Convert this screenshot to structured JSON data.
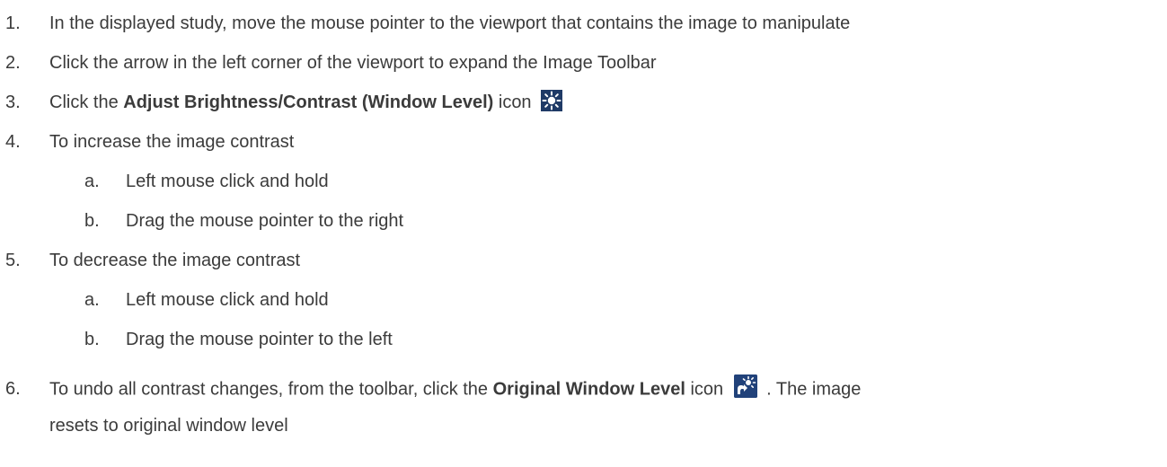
{
  "steps": [
    {
      "num": "1.",
      "text": "In the displayed study, move the mouse pointer to the viewport that contains the image to manipulate"
    },
    {
      "num": "2.",
      "text": "Click the arrow in the left corner of the viewport to expand the Image Toolbar"
    },
    {
      "num": "3.",
      "pre": "Click the ",
      "bold": "Adjust Brightness/Contrast (Window Level)",
      "post": " icon",
      "icon": "brightness-sun-icon"
    },
    {
      "num": "4.",
      "text": "To increase the image contrast",
      "sub": [
        {
          "num": "a.",
          "text": "Left mouse click and hold"
        },
        {
          "num": "b.",
          "text": "Drag the mouse pointer to the right"
        }
      ]
    },
    {
      "num": "5.",
      "text": "To decrease the image contrast",
      "sub": [
        {
          "num": "a.",
          "text": "Left mouse click and hold"
        },
        {
          "num": "b.",
          "text": "Drag the mouse pointer to the left"
        }
      ]
    },
    {
      "num": "6.",
      "pre": "To undo all contrast changes, from the toolbar, click the ",
      "bold": "Original Window Level",
      "post": " icon",
      "icon": "original-window-level-icon",
      "after_icon": ".  The image",
      "continuation": "resets to original window level"
    }
  ],
  "colors": {
    "text": "#3b3b3b",
    "icon_bg": "#1f3a66"
  }
}
